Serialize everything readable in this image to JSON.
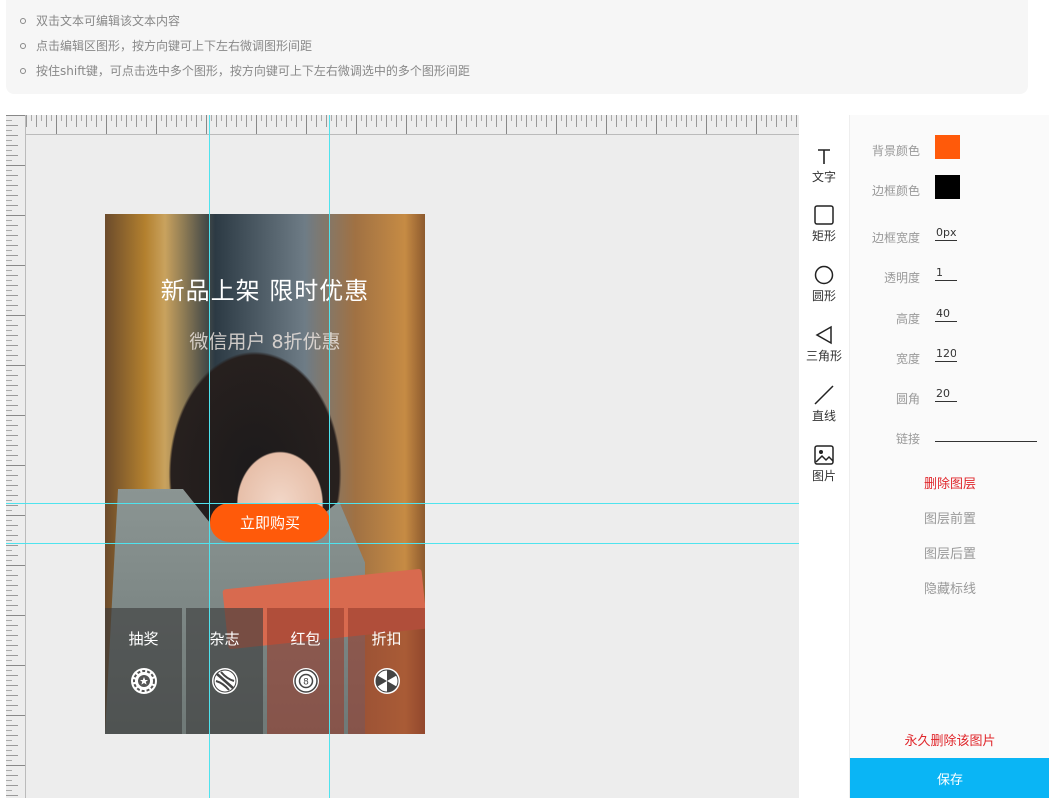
{
  "tips": [
    "双击文本可编辑该文本内容",
    "点击编辑区图形，按方向键可上下左右微调图形间距",
    "按住shift键，可点击选中多个图形，按方向键可上下左右微调选中的多个图形间距"
  ],
  "poster": {
    "headline": "新品上架 限时优惠",
    "subline": "微信用户 8折优惠",
    "buy_button": "立即购买",
    "tabs": [
      {
        "label": "抽奖",
        "icon": "star-coin-icon"
      },
      {
        "label": "杂志",
        "icon": "baseball-icon"
      },
      {
        "label": "红包",
        "icon": "eight-ball-icon"
      },
      {
        "label": "折扣",
        "icon": "pinwheel-icon"
      }
    ]
  },
  "tools": [
    {
      "label": "文字",
      "icon": "text-tool-icon"
    },
    {
      "label": "矩形",
      "icon": "rectangle-icon"
    },
    {
      "label": "圆形",
      "icon": "circle-icon"
    },
    {
      "label": "三角形",
      "icon": "triangle-icon"
    },
    {
      "label": "直线",
      "icon": "line-icon"
    },
    {
      "label": "图片",
      "icon": "image-icon"
    }
  ],
  "properties": {
    "bg_color_label": "背景颜色",
    "bg_color": "#ff5a0a",
    "border_color_label": "边框颜色",
    "border_color": "#000000",
    "border_width_label": "边框宽度",
    "border_width": "0px",
    "opacity_label": "透明度",
    "opacity": "1",
    "height_label": "高度",
    "height": "40",
    "width_label": "宽度",
    "width": "120",
    "radius_label": "圆角",
    "radius": "20",
    "link_label": "链接",
    "link": ""
  },
  "actions": {
    "delete_layer": "删除图层",
    "bring_forward": "图层前置",
    "send_backward": "图层后置",
    "hide_guides": "隐藏标线",
    "delete_image": "永久删除该图片",
    "save": "保存"
  }
}
